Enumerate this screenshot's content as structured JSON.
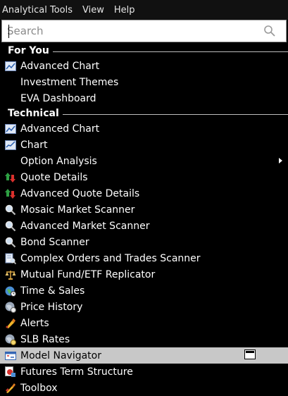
{
  "menubar": {
    "items": [
      {
        "label": "Analytical Tools"
      },
      {
        "label": "View"
      },
      {
        "label": "Help"
      }
    ]
  },
  "search": {
    "placeholder": "Search",
    "icon": "search-icon"
  },
  "sections": [
    {
      "title": "For You",
      "items": [
        {
          "label": "Advanced Chart",
          "icon": "advanced-chart-icon"
        },
        {
          "label": "Investment Themes",
          "icon": ""
        },
        {
          "label": "EVA Dashboard",
          "icon": ""
        }
      ]
    },
    {
      "title": "Technical",
      "items": [
        {
          "label": "Advanced Chart",
          "icon": "advanced-chart-icon"
        },
        {
          "label": "Chart",
          "icon": "chart-icon"
        },
        {
          "label": "Option Analysis",
          "icon": "",
          "submenu": true
        },
        {
          "label": "Quote Details",
          "icon": "quote-arrows-icon"
        },
        {
          "label": "Advanced Quote Details",
          "icon": "quote-arrows-icon"
        },
        {
          "label": "Mosaic Market Scanner",
          "icon": "magnifier-icon"
        },
        {
          "label": "Advanced Market Scanner",
          "icon": "magnifier-icon"
        },
        {
          "label": "Bond Scanner",
          "icon": "magnifier-icon"
        },
        {
          "label": "Complex Orders and Trades Scanner",
          "icon": "scanner-doc-icon"
        },
        {
          "label": "Mutual Fund/ETF Replicator",
          "icon": "scales-icon"
        },
        {
          "label": "Time & Sales",
          "icon": "clock-globe-icon"
        },
        {
          "label": "Price History",
          "icon": "globe-history-icon"
        },
        {
          "label": "Alerts",
          "icon": "alert-icon"
        },
        {
          "label": "SLB Rates",
          "icon": "globe-rates-icon"
        },
        {
          "label": "Model Navigator",
          "icon": "model-navigator-icon",
          "selected": true
        },
        {
          "label": "Futures Term Structure",
          "icon": "futures-icon"
        },
        {
          "label": "Toolbox",
          "icon": "toolbox-icon"
        }
      ]
    }
  ],
  "colors": {
    "background": "#000000",
    "selected": "#c8c8c8",
    "divider": "#bdbdbd"
  }
}
